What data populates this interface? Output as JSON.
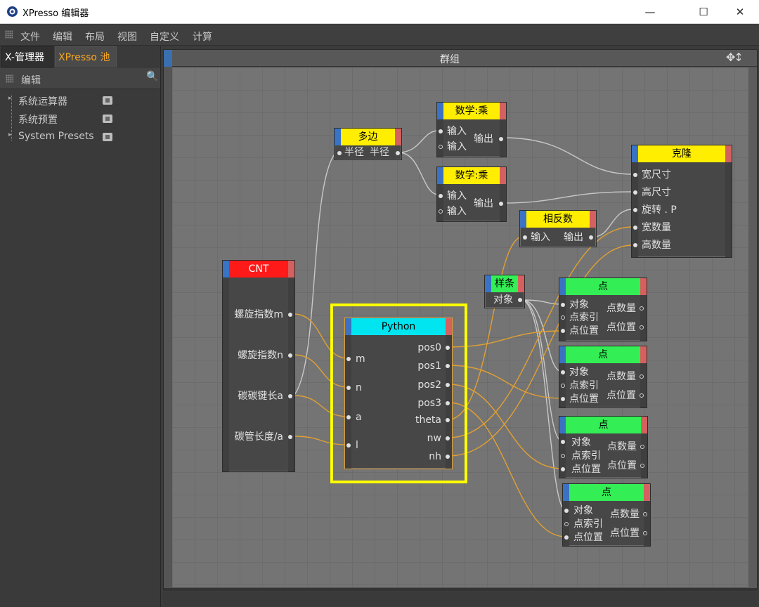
{
  "window": {
    "title": "XPresso 编辑器",
    "minimize": "—",
    "maximize": "☐",
    "close": "✕"
  },
  "menu": [
    "文件",
    "编辑",
    "布局",
    "视图",
    "自定义",
    "计算"
  ],
  "left_panel": {
    "tabs": [
      {
        "label": "X-管理器",
        "active": false
      },
      {
        "label": "XPresso 池",
        "active": true
      }
    ],
    "toolbar_label": "编辑",
    "search_icon": "🔍",
    "tree": [
      "系统运算器",
      "系统预置",
      "System Presets"
    ]
  },
  "group": {
    "title": "群组",
    "tools_icon": "✥↕"
  },
  "nodes": {
    "duobian": {
      "title": "多边",
      "ports": [
        "半径",
        "半径"
      ]
    },
    "mul1": {
      "title": "数学:乘",
      "in": [
        "输入",
        "输入"
      ],
      "out": "输出"
    },
    "mul2": {
      "title": "数学:乘",
      "in": [
        "输入",
        "输入"
      ],
      "out": "输出"
    },
    "clone": {
      "title": "克隆",
      "ports": [
        "宽尺寸",
        "高尺寸",
        "旋转 . P",
        "宽数量",
        "高数量"
      ]
    },
    "invert": {
      "title": "相反数",
      "in": "输入",
      "out": "输出"
    },
    "cnt": {
      "title": "CNT",
      "ports": [
        "螺旋指数m",
        "螺旋指数n",
        "碳碳键长a",
        "碳管长度/a"
      ]
    },
    "spline": {
      "title": "样条",
      "port": "对象"
    },
    "python": {
      "title": "Python",
      "in": [
        "m",
        "n",
        "a",
        "l"
      ],
      "out": [
        "pos0",
        "pos1",
        "pos2",
        "pos3",
        "theta",
        "nw",
        "nh"
      ]
    },
    "point": {
      "title": "点",
      "in": [
        "对象",
        "点索引",
        "点位置"
      ],
      "out": [
        "点数量",
        "点位置"
      ]
    }
  },
  "colors": {
    "header_yellow": "#ffee00",
    "header_red": "#ff1a1a",
    "header_cyan": "#00e5ef",
    "header_green": "#33ee55",
    "wire_orange": "#e0a033",
    "wire_white": "#c8c8c8",
    "highlight": "#ffff00"
  }
}
